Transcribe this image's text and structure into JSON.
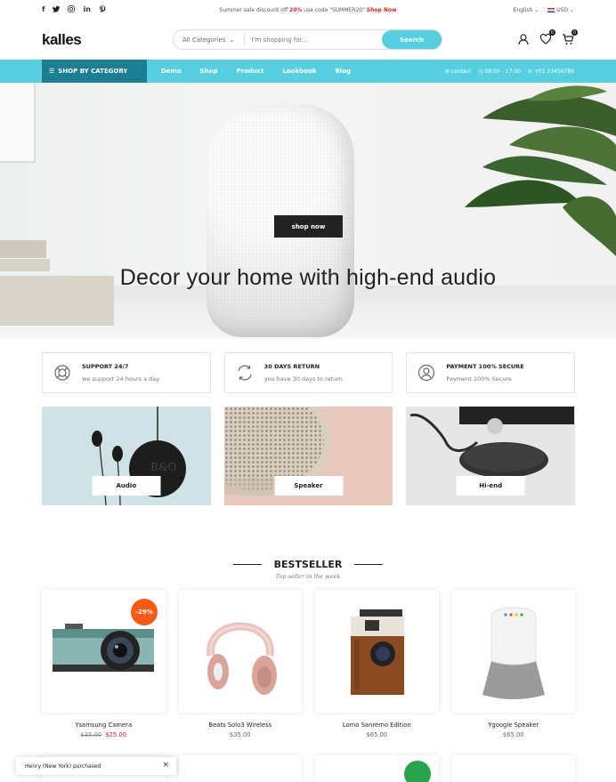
{
  "topbar": {
    "promo_prefix": "Summer sale discount off ",
    "promo_pct": "20%",
    "promo_mid": " use code \"SUMMER20\" ",
    "promo_link": "Shop Now",
    "language": "English",
    "currency": "USD",
    "social": [
      "facebook-icon",
      "twitter-icon",
      "instagram-icon",
      "linkedin-icon",
      "pinterest-icon"
    ]
  },
  "header": {
    "logo": "kalles",
    "search_category": "All Categories",
    "search_placeholder": "I'm shopping for...",
    "search_button": "Search",
    "wishlist_count": "0",
    "cart_count": "0"
  },
  "nav": {
    "category_label": "SHOP BY CATEGORY",
    "links": [
      "Demo",
      "Shop",
      "Product",
      "Lookbook",
      "Blog"
    ],
    "contact": "contact",
    "hours": "08:00 - 17:00",
    "phone": "+01 23456789"
  },
  "hero": {
    "headline": "Decor your home with high-end audio",
    "cta": "shop now"
  },
  "features": [
    {
      "icon": "support-icon",
      "title": "SUPPORT 24/7",
      "sub": "we support 24 hours a day"
    },
    {
      "icon": "return-icon",
      "title": "30 DAYS RETURN",
      "sub": "you have 30 days to return"
    },
    {
      "icon": "secure-payment-icon",
      "title": "PAYMENT 100% SECURE",
      "sub": "Payment 100% Secure"
    }
  ],
  "categories": [
    "Audio",
    "Speaker",
    "Hi-end"
  ],
  "bestseller": {
    "title": "BESTSELLER",
    "subtitle": "Top seller in the week",
    "products": [
      {
        "name": "Ysamsung Camera",
        "old_price": "$35.00",
        "price": "$25.00",
        "badge": "-29%"
      },
      {
        "name": "Beats Solo3 Wireless",
        "price": "$35.00"
      },
      {
        "name": "Lomo Sanremo Edition",
        "price": "$65.00"
      },
      {
        "name": "Ygoogle Speaker",
        "price": "$65.00"
      }
    ]
  },
  "toast": {
    "text": "Henry (New York) purchased"
  },
  "colors": {
    "accent": "#56cfe1",
    "nav_dark": "#1a7f93",
    "sale": "#f95a13",
    "price_red": "#e3202b"
  }
}
